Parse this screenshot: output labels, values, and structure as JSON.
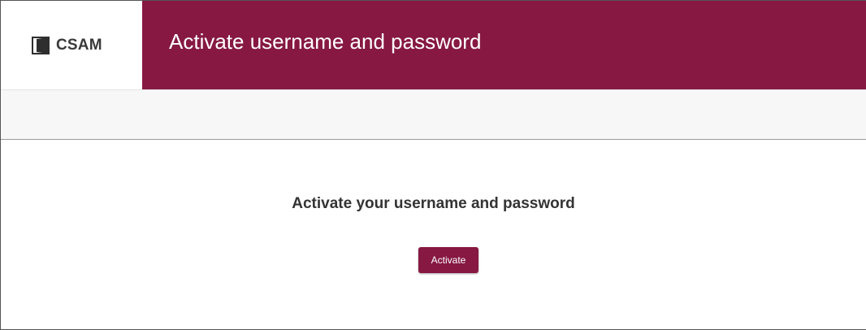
{
  "header": {
    "logo_text": "CSAM",
    "title": "Activate username and password"
  },
  "main": {
    "heading": "Activate your username and password",
    "activate_label": "Activate"
  },
  "colors": {
    "brand": "#861842",
    "subbar": "#f7f7f7",
    "heading_text": "#333333"
  },
  "icons": {
    "logo": "csam-door-logo-icon"
  }
}
